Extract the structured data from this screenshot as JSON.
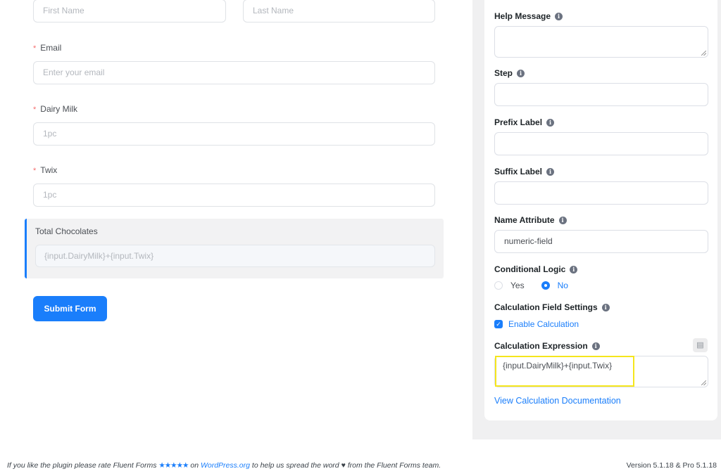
{
  "form": {
    "first_name_placeholder": "First Name",
    "last_name_placeholder": "Last Name",
    "required_marker": "*",
    "email_label": "Email",
    "email_placeholder": "Enter your email",
    "dairy_milk_label": "Dairy Milk",
    "dairy_milk_placeholder": "1pc",
    "twix_label": "Twix",
    "twix_placeholder": "1pc",
    "total_label": "Total Chocolates",
    "total_placeholder": "{input.DairyMilk}+{input.Twix}",
    "submit_label": "Submit Form"
  },
  "settings": {
    "help_message_label": "Help Message",
    "help_message_value": "",
    "step_label": "Step",
    "step_value": "",
    "prefix_label": "Prefix Label",
    "prefix_value": "",
    "suffix_label": "Suffix Label",
    "suffix_value": "",
    "name_attribute_label": "Name Attribute",
    "name_attribute_value": "numeric-field",
    "conditional_logic_label": "Conditional Logic",
    "conditional_logic_options": [
      "Yes",
      "No"
    ],
    "conditional_logic_selected": "No",
    "calc_settings_label": "Calculation Field Settings",
    "enable_calc_label": "Enable Calculation",
    "enable_calc_checked": true,
    "calc_expression_label": "Calculation Expression",
    "calc_expression_value": "{input.DairyMilk}+{input.Twix}",
    "doc_link_label": "View Calculation Documentation",
    "info_glyph": "i",
    "doc_icon_glyph": "▤"
  },
  "footer": {
    "text_before": "If you like the plugin please rate Fluent Forms ",
    "stars": "★★★★★",
    "text_on": " on ",
    "link_label": "WordPress.org",
    "text_after": " to help us spread the word ",
    "heart": "♥",
    "text_end": " from the Fluent Forms team.",
    "version": "Version 5.1.18 & Pro 5.1.18"
  },
  "colors": {
    "accent": "#1a7efb",
    "required": "#f56c6c",
    "highlight": "#f5e61d",
    "panel_bg": "#f0f0f1"
  }
}
